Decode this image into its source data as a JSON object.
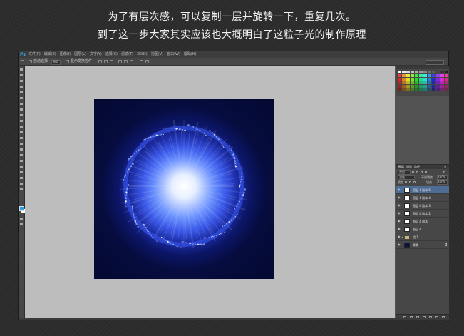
{
  "caption": {
    "line1": "为了有层次感，可以复制一层并旋转一下，重复几次。",
    "line2": "到了这一步大家其实应该也大概明白了这粒子光的制作原理"
  },
  "app": {
    "logo": "Ps",
    "menu": [
      "文件(F)",
      "编辑(E)",
      "图像(I)",
      "图层(L)",
      "文字(Y)",
      "选择(S)",
      "滤镜(T)",
      "3D(D)",
      "视图(V)",
      "窗口(W)",
      "帮助(H)"
    ]
  },
  "options_bar": {
    "auto_select_label": "自动选择",
    "auto_select_value": "图层",
    "transform_label": "显示变换控件"
  },
  "layers_panel": {
    "tabs": [
      "图层",
      "通道",
      "路径"
    ],
    "kind_label": "类型",
    "blend_mode": "滤色",
    "opacity_label": "不透明度",
    "opacity_value": "100%",
    "lock_label": "锁定",
    "fill_label": "填充",
    "fill_value": "100%",
    "layers": [
      {
        "name": "图层 4 副本 5",
        "thumb": "white",
        "selected": true
      },
      {
        "name": "图层 4 副本 4",
        "thumb": "white",
        "selected": false
      },
      {
        "name": "图层 4 副本 3",
        "thumb": "white",
        "selected": false
      },
      {
        "name": "图层 4 副本 2",
        "thumb": "white",
        "selected": false
      },
      {
        "name": "图层 4 副本",
        "thumb": "white",
        "selected": false
      },
      {
        "name": "图层 4",
        "thumb": "white",
        "selected": false
      },
      {
        "name": "组 1",
        "thumb": "folder",
        "selected": false
      },
      {
        "name": "背景",
        "thumb": "dark",
        "selected": false
      }
    ]
  },
  "colors": {
    "foreground": "#29a3e8",
    "background": "#ffffff",
    "canvas_center": "#ffffff",
    "canvas_edge": "#040930",
    "selection": "#4e6c94"
  }
}
